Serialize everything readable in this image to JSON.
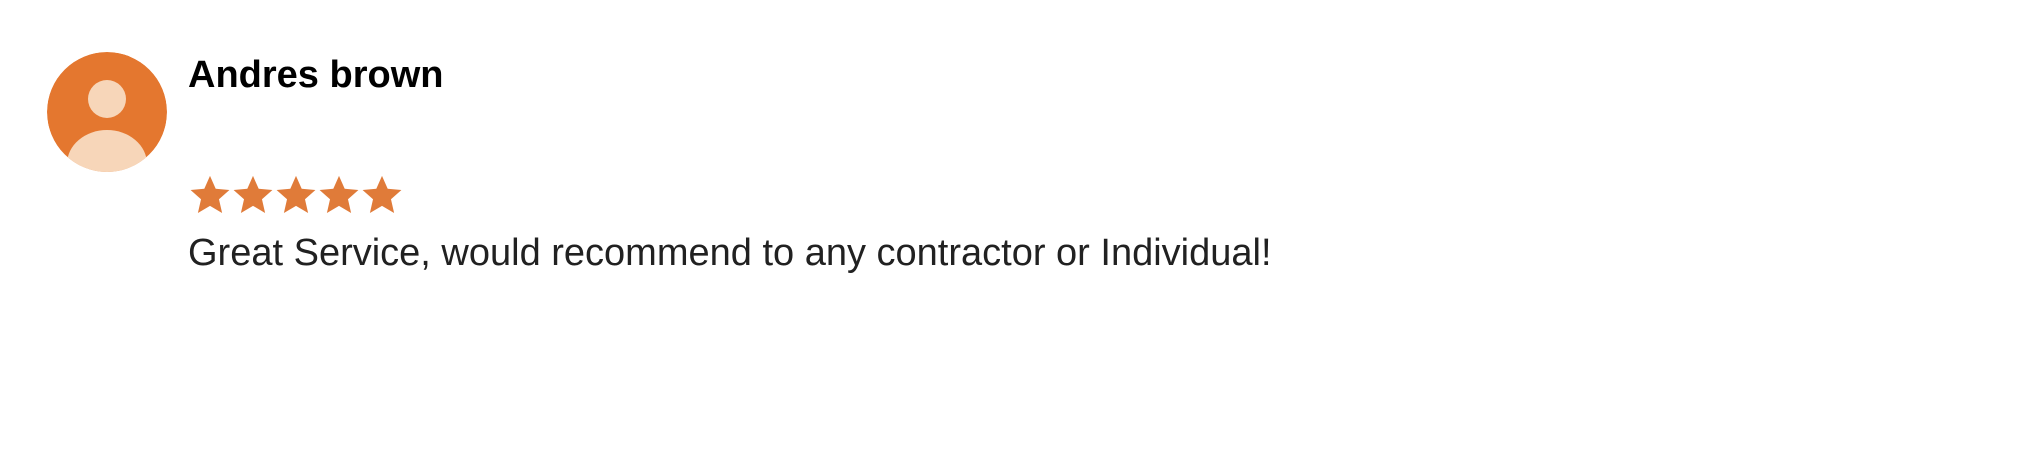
{
  "review": {
    "reviewer_name": "Andres brown",
    "avatar_icon": "default-user-icon",
    "rating": {
      "stars": 5,
      "max": 5
    },
    "text": "Great Service, would recommend to any contractor or Individual!"
  },
  "colors": {
    "avatar_background": "#E4772F",
    "avatar_figure": "#F7D6B9",
    "star": "#E07B39",
    "name": "#000000",
    "text": "#212121"
  }
}
